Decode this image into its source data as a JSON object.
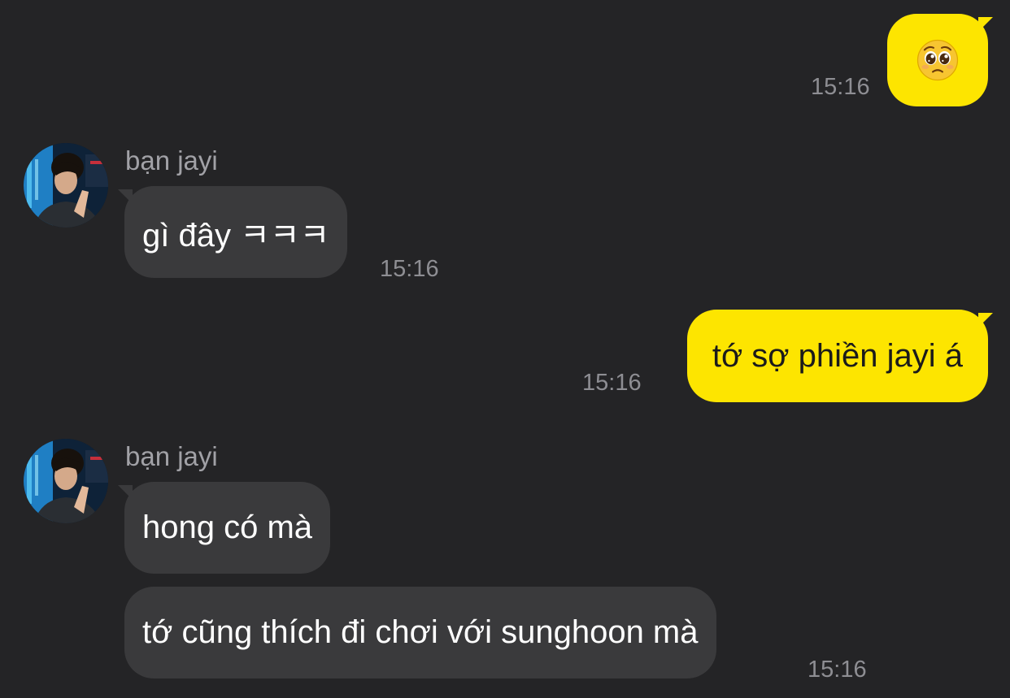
{
  "conversation": {
    "messages": [
      {
        "direction": "outgoing",
        "content": "🥺",
        "time": "15:16"
      },
      {
        "direction": "incoming",
        "sender": "bạn jayi",
        "text": "gì đây ㅋㅋㅋ",
        "time": "15:16"
      },
      {
        "direction": "outgoing",
        "text": "tớ sợ phiền jayi á",
        "time": "15:16"
      },
      {
        "direction": "incoming",
        "sender": "bạn jayi",
        "text": "hong có mà"
      },
      {
        "direction": "incoming",
        "text": "tớ cũng thích đi chơi với sunghoon mà",
        "time": "15:16"
      }
    ]
  },
  "colors": {
    "background": "#242426",
    "incoming_bubble": "#3a3a3c",
    "outgoing_bubble": "#fde500",
    "timestamp": "#8e8e93",
    "sender_name": "#a1a1a6"
  },
  "icons": {
    "outgoing_emoji": "pleading-face-icon",
    "avatar": "contact-avatar-photo"
  }
}
